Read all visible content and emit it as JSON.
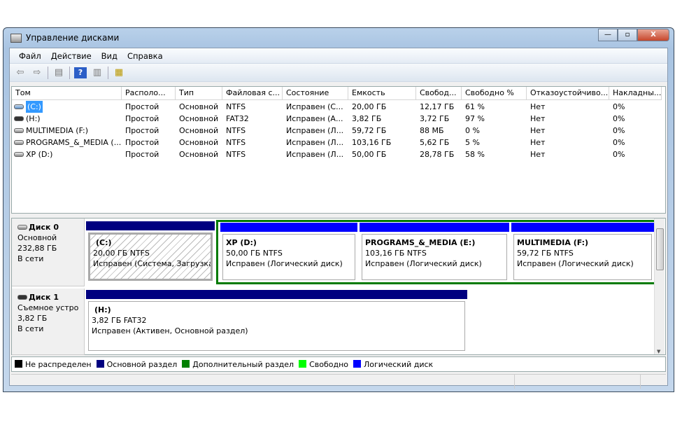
{
  "window": {
    "title": "Управление дисками",
    "minimize": "—",
    "maximize": "▫",
    "close": "X"
  },
  "menu": [
    "Файл",
    "Действие",
    "Вид",
    "Справка"
  ],
  "table": {
    "columns": [
      "Том",
      "Располо...",
      "Тип",
      "Файловая с...",
      "Состояние",
      "Емкость",
      "Свобод...",
      "Свободно %",
      "Отказоустойчиво...",
      "Накладны..."
    ],
    "rows": [
      [
        "(C:)",
        "Простой",
        "Основной",
        "NTFS",
        "Исправен (С...",
        "20,00 ГБ",
        "12,17 ГБ",
        "61 %",
        "Нет",
        "0%"
      ],
      [
        "(H:)",
        "Простой",
        "Основной",
        "FAT32",
        "Исправен (А...",
        "3,82 ГБ",
        "3,72 ГБ",
        "97 %",
        "Нет",
        "0%"
      ],
      [
        "MULTIMEDIA (F:)",
        "Простой",
        "Основной",
        "NTFS",
        "Исправен (Л...",
        "59,72 ГБ",
        "88 МБ",
        "0 %",
        "Нет",
        "0%"
      ],
      [
        "PROGRAMS_&_MEDIA (...",
        "Простой",
        "Основной",
        "NTFS",
        "Исправен (Л...",
        "103,16 ГБ",
        "5,62 ГБ",
        "5 %",
        "Нет",
        "0%"
      ],
      [
        "XP (D:)",
        "Простой",
        "Основной",
        "NTFS",
        "Исправен (Л...",
        "50,00 ГБ",
        "28,78 ГБ",
        "58 %",
        "Нет",
        "0%"
      ]
    ]
  },
  "disks": [
    {
      "name": "Диск 0",
      "type": "Основной",
      "size": "232,88 ГБ",
      "status": "В сети",
      "partitions": [
        {
          "name": "(C:)",
          "size": "20,00 ГБ NTFS",
          "status": "Исправен (Система, Загрузка, Файл подкачки, Активен, Аварийный дамп памяти, Основной раздел)"
        },
        {
          "name": "XP  (D:)",
          "size": "50,00 ГБ NTFS",
          "status": "Исправен (Логический диск)"
        },
        {
          "name": "PROGRAMS_&_MEDIA  (E:)",
          "size": "103,16 ГБ NTFS",
          "status": "Исправен (Логический диск)"
        },
        {
          "name": "MULTIMEDIA  (F:)",
          "size": "59,72 ГБ NTFS",
          "status": "Исправен (Логический диск)"
        }
      ]
    },
    {
      "name": "Диск 1",
      "type": "Съемное устройство",
      "size": "3,82 ГБ",
      "status": "В сети",
      "partitions": [
        {
          "name": "(H:)",
          "size": "3,82 ГБ FAT32",
          "status": "Исправен (Активен, Основной раздел)"
        }
      ]
    }
  ],
  "legend": [
    {
      "label": "Не распределен",
      "color": "#000000"
    },
    {
      "label": "Основной раздел",
      "color": "#000080"
    },
    {
      "label": "Дополнительный раздел",
      "color": "#008000"
    },
    {
      "label": "Свободно",
      "color": "#00ff00"
    },
    {
      "label": "Логический диск",
      "color": "#0000ff"
    }
  ]
}
